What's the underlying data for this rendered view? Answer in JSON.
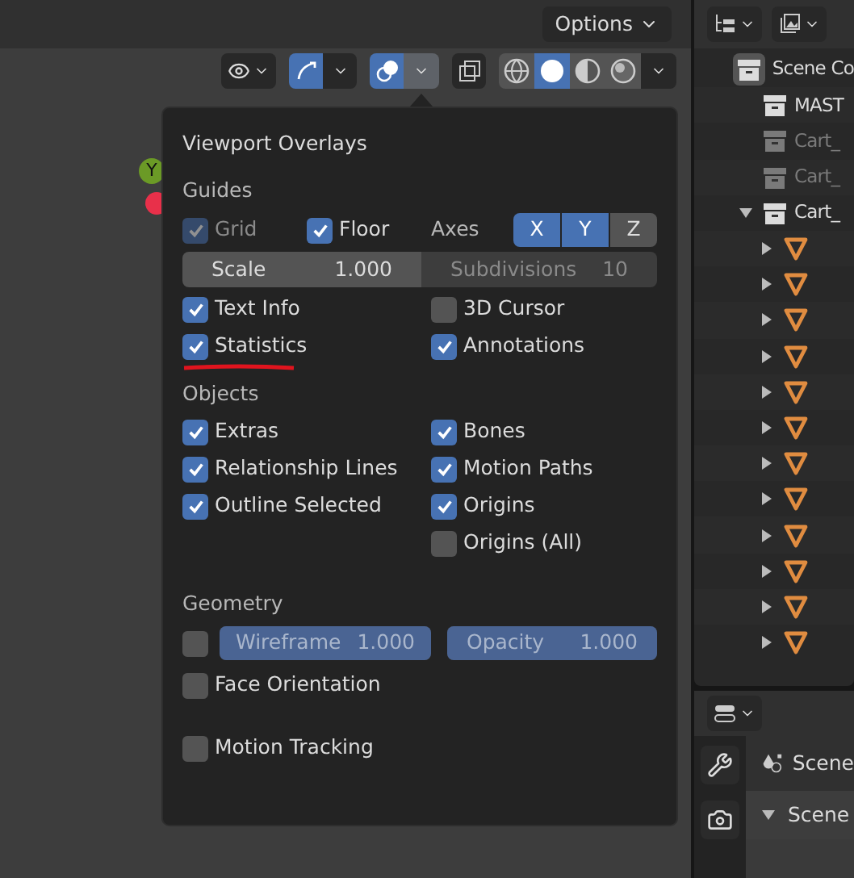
{
  "header": {
    "options_button": "Options"
  },
  "viewport_toolbar": {
    "gizmo_on": true,
    "overlays_on": true,
    "overlays_open": true,
    "shading": [
      {
        "kind": "wireframe",
        "selected": false
      },
      {
        "kind": "solid",
        "selected": true
      },
      {
        "kind": "material",
        "selected": false
      },
      {
        "kind": "rendered",
        "selected": false
      }
    ]
  },
  "axis_gizmo": {
    "y_label": "Y"
  },
  "overlays": {
    "title": "Viewport Overlays",
    "guides": {
      "heading": "Guides",
      "grid": {
        "label": "Grid",
        "checked": true,
        "disabled": true
      },
      "floor": {
        "label": "Floor",
        "checked": true,
        "disabled": false
      },
      "axes_label": "Axes",
      "axes": [
        {
          "label": "X",
          "selected": true
        },
        {
          "label": "Y",
          "selected": true
        },
        {
          "label": "Z",
          "selected": false
        }
      ],
      "scale": {
        "label": "Scale",
        "value": "1.000",
        "disabled": false
      },
      "subdivisions": {
        "label": "Subdivisions",
        "value": "10",
        "disabled": true
      },
      "rows": [
        [
          {
            "label": "Text Info",
            "checked": true
          },
          {
            "label": "3D Cursor",
            "checked": false
          }
        ],
        [
          {
            "label": "Statistics",
            "checked": true,
            "underlined": true
          },
          {
            "label": "Annotations",
            "checked": true
          }
        ]
      ]
    },
    "objects": {
      "heading": "Objects",
      "rows": [
        [
          {
            "label": "Extras",
            "checked": true
          },
          {
            "label": "Bones",
            "checked": true
          }
        ],
        [
          {
            "label": "Relationship Lines",
            "checked": true
          },
          {
            "label": "Motion Paths",
            "checked": true
          }
        ],
        [
          {
            "label": "Outline Selected",
            "checked": true
          },
          {
            "label": "Origins",
            "checked": true
          }
        ],
        [
          null,
          {
            "label": "Origins (All)",
            "checked": false
          }
        ]
      ]
    },
    "geometry": {
      "heading": "Geometry",
      "wireframe_checked": false,
      "wireframe": {
        "label": "Wireframe",
        "value": "1.000",
        "level": 1
      },
      "opacity": {
        "label": "Opacity",
        "value": "1.000",
        "level": 1
      },
      "face_orientation": {
        "label": "Face Orientation",
        "checked": false
      },
      "motion_tracking": {
        "label": "Motion Tracking",
        "checked": false
      }
    }
  },
  "outliner": {
    "items": [
      {
        "kind": "scene",
        "label": "Scene Co",
        "dimmed": false,
        "children": [
          {
            "kind": "collection",
            "label": "MAST",
            "dimmed": false
          },
          {
            "kind": "collection",
            "label": "Cart_",
            "dimmed": true
          },
          {
            "kind": "collection",
            "label": "Cart_",
            "dimmed": true
          },
          {
            "kind": "collection",
            "label": "Cart_",
            "dimmed": false,
            "expanded": true,
            "children": [
              {
                "kind": "mesh",
                "expanded": false
              },
              {
                "kind": "mesh",
                "expanded": false
              },
              {
                "kind": "mesh",
                "expanded": false
              },
              {
                "kind": "mesh",
                "expanded": false
              },
              {
                "kind": "mesh",
                "expanded": false
              },
              {
                "kind": "mesh",
                "expanded": false
              },
              {
                "kind": "mesh",
                "expanded": false
              },
              {
                "kind": "mesh",
                "expanded": false
              },
              {
                "kind": "mesh",
                "expanded": false
              },
              {
                "kind": "mesh",
                "expanded": false
              },
              {
                "kind": "mesh",
                "expanded": false
              },
              {
                "kind": "mesh",
                "expanded": false
              }
            ]
          }
        ]
      }
    ]
  },
  "properties": {
    "context": "Scene",
    "panel": {
      "title": "Scene",
      "expanded": true
    }
  }
}
